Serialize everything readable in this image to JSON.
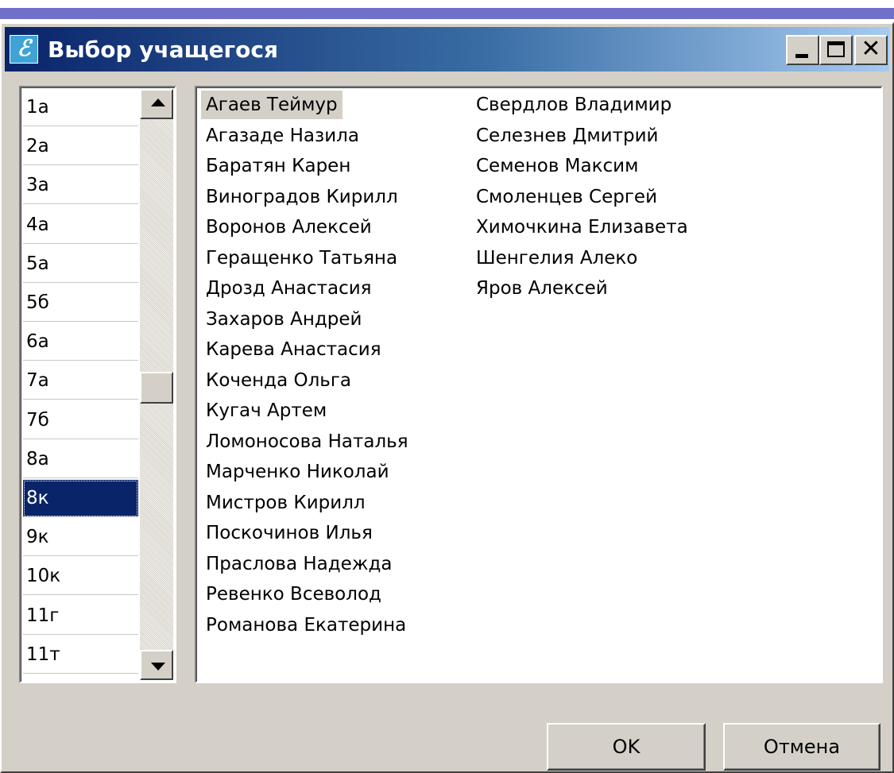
{
  "window": {
    "title": "Выбор учащегося",
    "app_icon": "app-logo-icon"
  },
  "titlebar_buttons": {
    "close_glyph": "✕"
  },
  "classes": {
    "items": [
      "1а",
      "2а",
      "3а",
      "4а",
      "5а",
      "5б",
      "6а",
      "7а",
      "7б",
      "8а",
      "8к",
      "9к",
      "10к",
      "11г",
      "11т"
    ],
    "selected": "8к"
  },
  "students": {
    "column1": [
      "Агаев Теймур",
      "Агазаде Назила",
      "Баратян Карен",
      "Виноградов Кирилл",
      "Воронов Алексей",
      "Геращенко Татьяна",
      "Дрозд Анастасия",
      "Захаров Андрей",
      "Карева Анастасия",
      "Коченда Ольга",
      "Кугач Артем",
      "Ломоносова Наталья",
      "Марченко Николай",
      "Мистров Кирилл",
      "Поскочинов Илья",
      "Праслова Надежда",
      "Ревенко Всеволод",
      "Романова Екатерина"
    ],
    "column2": [
      "Свердлов Владимир",
      "Селезнев Дмитрий",
      "Семенов Максим",
      "Смоленцев Сергей",
      "Химочкина Елизавета",
      "Шенгелия Алеко",
      "Яров Алексей"
    ],
    "focused": "Агаев Теймур"
  },
  "buttons": {
    "ok_label": "OK",
    "cancel_label": "Отмена"
  },
  "colors": {
    "titlebar_start": "#0a246a",
    "selection": "#0a246a",
    "face": "#d4d0c8"
  }
}
